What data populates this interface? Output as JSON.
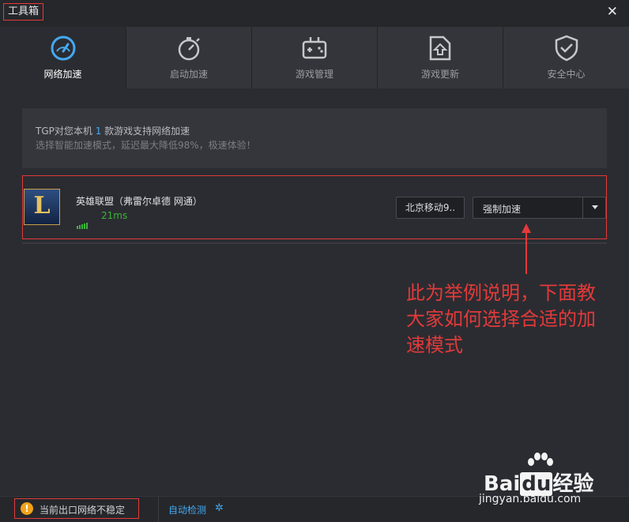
{
  "window": {
    "title": "工具箱",
    "close_glyph": "✕"
  },
  "tabs": [
    {
      "label": "网络加速",
      "icon": "speedometer-icon",
      "active": true
    },
    {
      "label": "启动加速",
      "icon": "stopwatch-icon",
      "active": false
    },
    {
      "label": "游戏管理",
      "icon": "gamepad-icon",
      "active": false
    },
    {
      "label": "游戏更新",
      "icon": "update-folder-icon",
      "active": false
    },
    {
      "label": "安全中心",
      "icon": "shield-check-icon",
      "active": false
    }
  ],
  "info": {
    "prefix": "TGP对您本机",
    "count": "1",
    "suffix": "款游戏支持网络加速",
    "subtitle": "选择智能加速模式，延迟最大降低98%，极速体验！"
  },
  "game": {
    "icon_letter": "L",
    "name": "英雄联盟（弗雷尔卓德 网通）",
    "ping": "21ms",
    "server_button": "北京移动9..",
    "mode_select": {
      "value": "强制加速"
    }
  },
  "annotation": {
    "text": "此为举例说明，下面教大家如何选择合适的加速模式"
  },
  "status": {
    "warning_glyph": "!",
    "warning": "当前出口网络不稳定",
    "auto_detect": "自动检测",
    "gear_glyph": "✲"
  },
  "watermark": {
    "logo_left": "Bai",
    "logo_du": "du",
    "logo_right": "经验",
    "url": "jingyan.baidu.com"
  },
  "colors": {
    "accent": "#44a9f2",
    "highlight_red": "#e23a3a",
    "good_green": "#3bb339",
    "warning_orange": "#f2a21a"
  }
}
